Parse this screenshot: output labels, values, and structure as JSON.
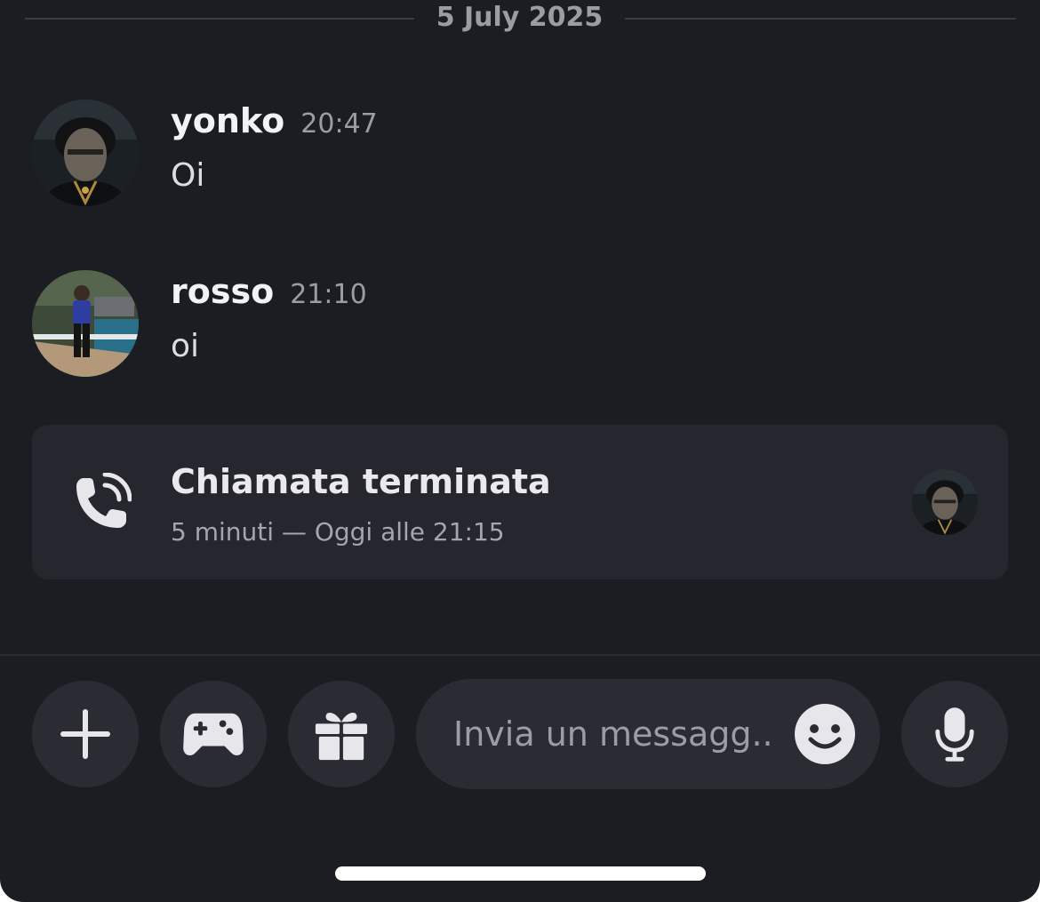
{
  "chat": {
    "date_separator": "5 July 2025",
    "messages": [
      {
        "author": "yonko",
        "time": "20:47",
        "text": "Oi"
      },
      {
        "author": "rosso",
        "time": "21:10",
        "text": "oi"
      }
    ],
    "call": {
      "title": "Chiamata terminata",
      "subtitle": "5 minuti — Oggi alle 21:15",
      "icon": "phone-call-icon"
    }
  },
  "composer": {
    "placeholder": "Invia un messagg..",
    "buttons": [
      "plus-icon",
      "gamepad-icon",
      "gift-icon",
      "microphone-icon"
    ],
    "emoji_icon": "smiley-icon"
  },
  "colors": {
    "background": "#1c1d22",
    "card": "#26272e",
    "button": "#2b2c33",
    "muted_text": "#9b9ca4"
  }
}
